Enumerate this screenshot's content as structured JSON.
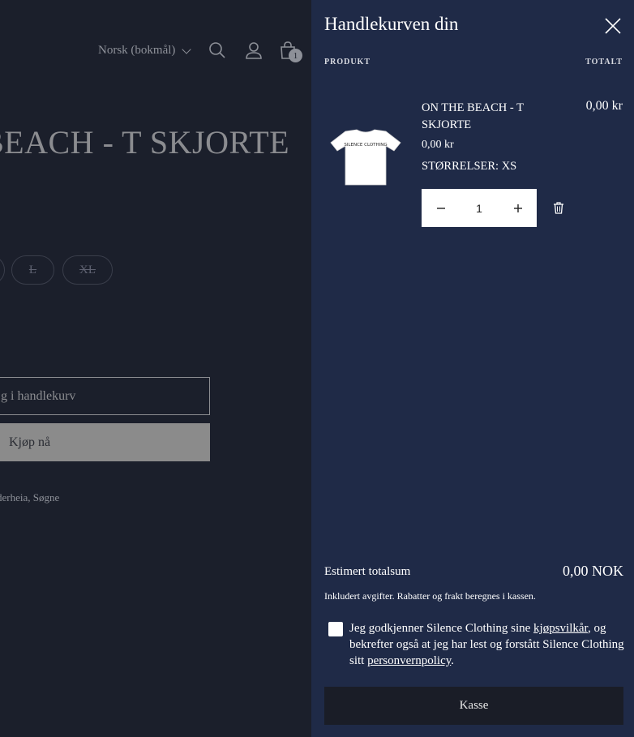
{
  "background_page": {
    "language_selector": "Norsk (bokmål)",
    "cart_count": "1",
    "product_title": "BEACH - T SKJORTE",
    "sizes": [
      "L",
      "XL"
    ],
    "add_to_cart_label": "g i handlekurv",
    "buy_now_label": "Kjøp nå",
    "pickup_location": "derheia, Søgne"
  },
  "drawer": {
    "title": "Handlekurven din",
    "col_product": "PRODUKT",
    "col_total": "TOTALT",
    "item": {
      "name": "ON THE BEACH - T SKJORTE",
      "total": "0,00 kr",
      "price": "0,00 kr",
      "size": "STØRRELSER: XS",
      "quantity": "1",
      "thumb_text": "SILENCE CLOTHING"
    },
    "estimated_label": "Estimert totalsum",
    "estimated_value": "0,00 NOK",
    "tax_note": "Inkludert avgifter. Rabatter og frakt beregnes i kassen.",
    "terms": {
      "part1": "Jeg godkjenner Silence Clothing sine ",
      "link1": "kjøpsvilkår",
      "part2": ", og bekrefter også at jeg har lest og forstått Silence Clothing sitt ",
      "link2": "personvernpolicy",
      "part3": "."
    },
    "checkout_label": "Kasse"
  },
  "colors": {
    "background": "#1b1f2b",
    "drawer": "#1f2a47",
    "button_dark": "#1a1d27"
  }
}
